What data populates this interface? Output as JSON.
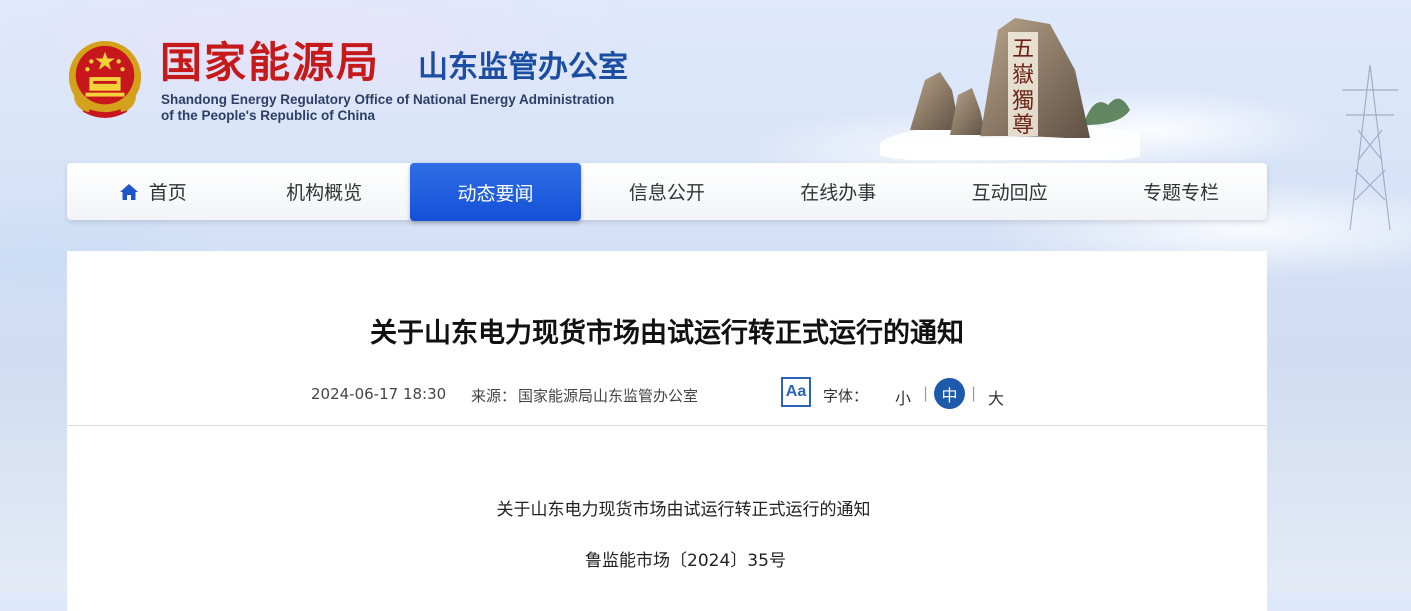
{
  "header": {
    "title_cn": "国家能源局",
    "subtitle_cn": "山东监管办公室",
    "title_en_line1": "Shandong Energy Regulatory Office of National Energy Administration",
    "title_en_line2": "of the People's Republic of China",
    "mountain_text": "五嶽獨尊"
  },
  "nav": {
    "items": [
      {
        "label": "首页",
        "icon": "home-icon"
      },
      {
        "label": "机构概览"
      },
      {
        "label": "动态要闻",
        "active": true
      },
      {
        "label": "信息公开"
      },
      {
        "label": "在线办事"
      },
      {
        "label": "互动回应"
      },
      {
        "label": "专题专栏"
      }
    ]
  },
  "article": {
    "title": "关于山东电力现货市场由试运行转正式运行的通知",
    "date": "2024-06-17 18:30",
    "source_label": "来源：",
    "source": "国家能源局山东监管办公室",
    "font_icon": "Aa",
    "font_label": "字体：",
    "font_small": "小",
    "font_medium": "中",
    "font_large": "大",
    "separator": "|",
    "body_title": "关于山东电力现货市场由试运行转正式运行的通知",
    "doc_number": "鲁监能市场〔2024〕35号"
  },
  "colors": {
    "brand_red": "#c61a1a",
    "brand_blue": "#1b4ea3",
    "nav_active": "#1450d8",
    "font_mid_bg": "#1d5aaa"
  }
}
